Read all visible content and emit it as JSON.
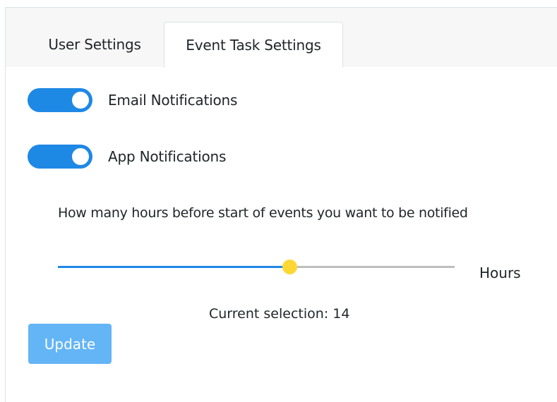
{
  "tabs": [
    {
      "label": "User Settings",
      "active": false
    },
    {
      "label": "Event Task Settings",
      "active": true
    }
  ],
  "notifications": [
    {
      "label": "Email Notifications",
      "enabled": true
    },
    {
      "label": "App Notifications",
      "enabled": true
    }
  ],
  "hours": {
    "question": "How many hours before start of events you want to be notified",
    "unit": "Hours",
    "value": 14,
    "min": 0,
    "max": 24,
    "selection_text": "Current selection: 14"
  },
  "update_button": {
    "label": "Update"
  },
  "colors": {
    "accent": "#1e88e5",
    "slider_thumb": "#fdd835",
    "button_disabled": "#64b5f6",
    "tab_bar": "#f7f7f7"
  }
}
